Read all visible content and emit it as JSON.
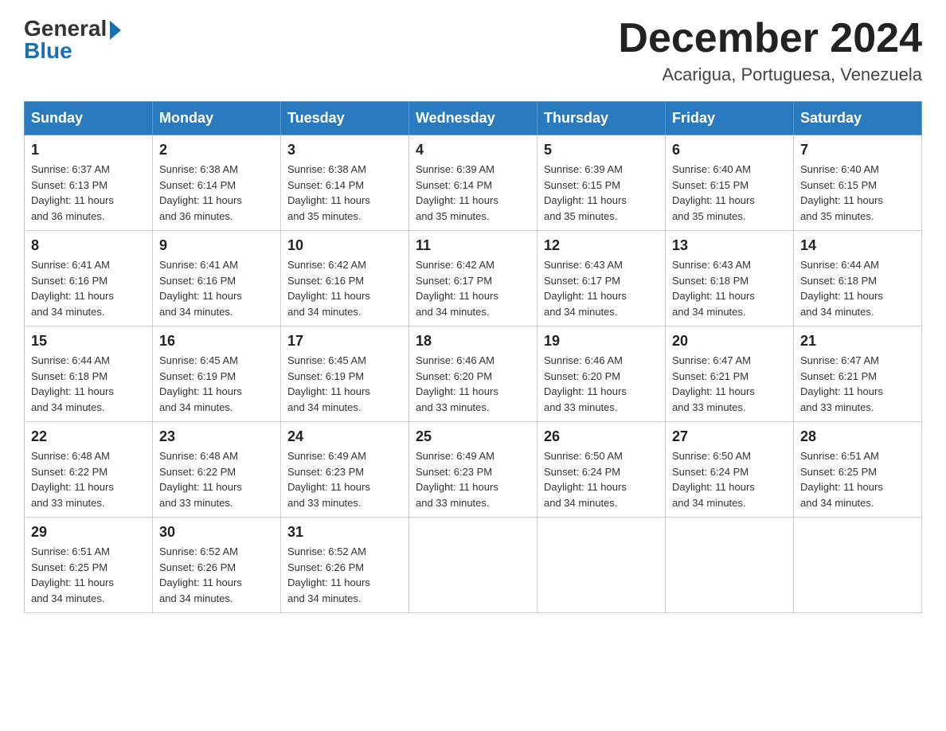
{
  "header": {
    "logo_general": "General",
    "logo_blue": "Blue",
    "month_year": "December 2024",
    "location": "Acarigua, Portuguesa, Venezuela"
  },
  "days_of_week": [
    "Sunday",
    "Monday",
    "Tuesday",
    "Wednesday",
    "Thursday",
    "Friday",
    "Saturday"
  ],
  "weeks": [
    [
      {
        "num": "1",
        "sunrise": "6:37 AM",
        "sunset": "6:13 PM",
        "daylight": "11 hours and 36 minutes."
      },
      {
        "num": "2",
        "sunrise": "6:38 AM",
        "sunset": "6:14 PM",
        "daylight": "11 hours and 36 minutes."
      },
      {
        "num": "3",
        "sunrise": "6:38 AM",
        "sunset": "6:14 PM",
        "daylight": "11 hours and 35 minutes."
      },
      {
        "num": "4",
        "sunrise": "6:39 AM",
        "sunset": "6:14 PM",
        "daylight": "11 hours and 35 minutes."
      },
      {
        "num": "5",
        "sunrise": "6:39 AM",
        "sunset": "6:15 PM",
        "daylight": "11 hours and 35 minutes."
      },
      {
        "num": "6",
        "sunrise": "6:40 AM",
        "sunset": "6:15 PM",
        "daylight": "11 hours and 35 minutes."
      },
      {
        "num": "7",
        "sunrise": "6:40 AM",
        "sunset": "6:15 PM",
        "daylight": "11 hours and 35 minutes."
      }
    ],
    [
      {
        "num": "8",
        "sunrise": "6:41 AM",
        "sunset": "6:16 PM",
        "daylight": "11 hours and 34 minutes."
      },
      {
        "num": "9",
        "sunrise": "6:41 AM",
        "sunset": "6:16 PM",
        "daylight": "11 hours and 34 minutes."
      },
      {
        "num": "10",
        "sunrise": "6:42 AM",
        "sunset": "6:16 PM",
        "daylight": "11 hours and 34 minutes."
      },
      {
        "num": "11",
        "sunrise": "6:42 AM",
        "sunset": "6:17 PM",
        "daylight": "11 hours and 34 minutes."
      },
      {
        "num": "12",
        "sunrise": "6:43 AM",
        "sunset": "6:17 PM",
        "daylight": "11 hours and 34 minutes."
      },
      {
        "num": "13",
        "sunrise": "6:43 AM",
        "sunset": "6:18 PM",
        "daylight": "11 hours and 34 minutes."
      },
      {
        "num": "14",
        "sunrise": "6:44 AM",
        "sunset": "6:18 PM",
        "daylight": "11 hours and 34 minutes."
      }
    ],
    [
      {
        "num": "15",
        "sunrise": "6:44 AM",
        "sunset": "6:18 PM",
        "daylight": "11 hours and 34 minutes."
      },
      {
        "num": "16",
        "sunrise": "6:45 AM",
        "sunset": "6:19 PM",
        "daylight": "11 hours and 34 minutes."
      },
      {
        "num": "17",
        "sunrise": "6:45 AM",
        "sunset": "6:19 PM",
        "daylight": "11 hours and 34 minutes."
      },
      {
        "num": "18",
        "sunrise": "6:46 AM",
        "sunset": "6:20 PM",
        "daylight": "11 hours and 33 minutes."
      },
      {
        "num": "19",
        "sunrise": "6:46 AM",
        "sunset": "6:20 PM",
        "daylight": "11 hours and 33 minutes."
      },
      {
        "num": "20",
        "sunrise": "6:47 AM",
        "sunset": "6:21 PM",
        "daylight": "11 hours and 33 minutes."
      },
      {
        "num": "21",
        "sunrise": "6:47 AM",
        "sunset": "6:21 PM",
        "daylight": "11 hours and 33 minutes."
      }
    ],
    [
      {
        "num": "22",
        "sunrise": "6:48 AM",
        "sunset": "6:22 PM",
        "daylight": "11 hours and 33 minutes."
      },
      {
        "num": "23",
        "sunrise": "6:48 AM",
        "sunset": "6:22 PM",
        "daylight": "11 hours and 33 minutes."
      },
      {
        "num": "24",
        "sunrise": "6:49 AM",
        "sunset": "6:23 PM",
        "daylight": "11 hours and 33 minutes."
      },
      {
        "num": "25",
        "sunrise": "6:49 AM",
        "sunset": "6:23 PM",
        "daylight": "11 hours and 33 minutes."
      },
      {
        "num": "26",
        "sunrise": "6:50 AM",
        "sunset": "6:24 PM",
        "daylight": "11 hours and 34 minutes."
      },
      {
        "num": "27",
        "sunrise": "6:50 AM",
        "sunset": "6:24 PM",
        "daylight": "11 hours and 34 minutes."
      },
      {
        "num": "28",
        "sunrise": "6:51 AM",
        "sunset": "6:25 PM",
        "daylight": "11 hours and 34 minutes."
      }
    ],
    [
      {
        "num": "29",
        "sunrise": "6:51 AM",
        "sunset": "6:25 PM",
        "daylight": "11 hours and 34 minutes."
      },
      {
        "num": "30",
        "sunrise": "6:52 AM",
        "sunset": "6:26 PM",
        "daylight": "11 hours and 34 minutes."
      },
      {
        "num": "31",
        "sunrise": "6:52 AM",
        "sunset": "6:26 PM",
        "daylight": "11 hours and 34 minutes."
      },
      null,
      null,
      null,
      null
    ]
  ],
  "labels": {
    "sunrise": "Sunrise:",
    "sunset": "Sunset:",
    "daylight": "Daylight:"
  }
}
